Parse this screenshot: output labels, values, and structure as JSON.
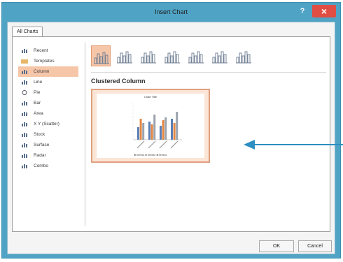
{
  "window": {
    "title": "Insert Chart",
    "help": "?",
    "close": "×"
  },
  "tabs": [
    {
      "label": "All Charts"
    }
  ],
  "chart_types": [
    {
      "label": "Recent",
      "icon": "recent-icon"
    },
    {
      "label": "Templates",
      "icon": "folder-icon"
    },
    {
      "label": "Column",
      "icon": "column-chart-icon",
      "selected": true
    },
    {
      "label": "Line",
      "icon": "line-chart-icon"
    },
    {
      "label": "Pie",
      "icon": "pie-chart-icon"
    },
    {
      "label": "Bar",
      "icon": "bar-chart-icon"
    },
    {
      "label": "Area",
      "icon": "area-chart-icon"
    },
    {
      "label": "X Y (Scatter)",
      "icon": "scatter-chart-icon"
    },
    {
      "label": "Stock",
      "icon": "stock-chart-icon"
    },
    {
      "label": "Surface",
      "icon": "surface-chart-icon"
    },
    {
      "label": "Radar",
      "icon": "radar-chart-icon"
    },
    {
      "label": "Combo",
      "icon": "combo-chart-icon"
    }
  ],
  "subtypes": [
    {
      "icon": "clustered-column-icon",
      "selected": true
    },
    {
      "icon": "stacked-column-icon"
    },
    {
      "icon": "100-stacked-column-icon"
    },
    {
      "icon": "3d-clustered-column-icon"
    },
    {
      "icon": "3d-stacked-column-icon"
    },
    {
      "icon": "3d-100-stacked-column-icon"
    },
    {
      "icon": "3d-column-icon"
    }
  ],
  "selected_subtype": "Clustered Column",
  "preview": {
    "chart_title": "Chart Title",
    "legend": "■ Series1  ■ Series2  ■ Series3"
  },
  "buttons": {
    "ok": "OK",
    "cancel": "Cancel"
  },
  "colors": {
    "accent": "#f6c6a9",
    "accent_border": "#e39a70",
    "window_frame": "#4fa3c4",
    "close": "#e04d43",
    "arrow": "#2d8fc2"
  }
}
